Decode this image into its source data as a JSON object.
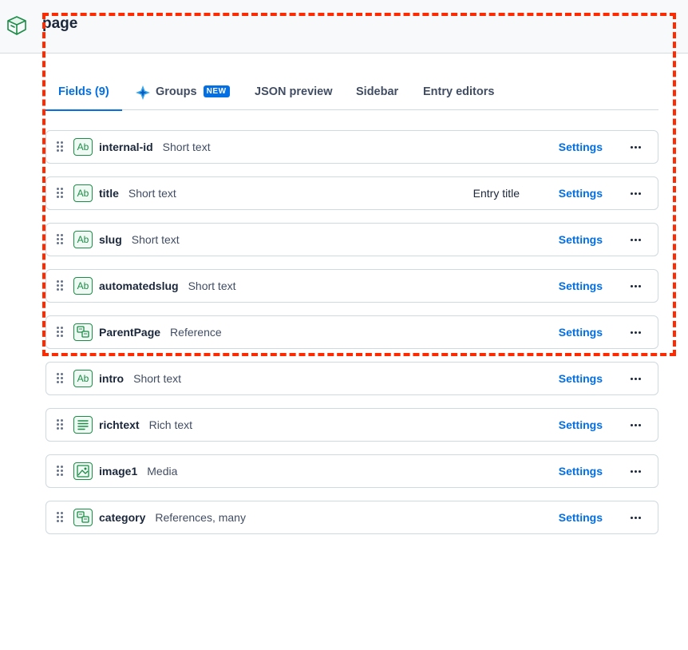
{
  "header": {
    "title": "page"
  },
  "tabs": {
    "fields": "Fields (9)",
    "groups": "Groups",
    "groups_badge": "NEW",
    "json": "JSON preview",
    "sidebar": "Sidebar",
    "entry_editors": "Entry editors"
  },
  "fields": [
    {
      "name": "internal-id",
      "type": "Short text",
      "icon": "short-text-icon",
      "extra": "",
      "settings": "Settings"
    },
    {
      "name": "title",
      "type": "Short text",
      "icon": "short-text-icon",
      "extra": "Entry title",
      "settings": "Settings"
    },
    {
      "name": "slug",
      "type": "Short text",
      "icon": "short-text-icon",
      "extra": "",
      "settings": "Settings"
    },
    {
      "name": "automatedslug",
      "type": "Short text",
      "icon": "short-text-icon",
      "extra": "",
      "settings": "Settings"
    },
    {
      "name": "ParentPage",
      "type": "Reference",
      "icon": "reference-icon",
      "extra": "",
      "settings": "Settings"
    },
    {
      "name": "intro",
      "type": "Short text",
      "icon": "short-text-icon",
      "extra": "",
      "settings": "Settings"
    },
    {
      "name": "richtext",
      "type": "Rich text",
      "icon": "rich-text-icon",
      "extra": "",
      "settings": "Settings"
    },
    {
      "name": "image1",
      "type": "Media",
      "icon": "media-icon",
      "extra": "",
      "settings": "Settings"
    },
    {
      "name": "category",
      "type": "References, many",
      "icon": "reference-icon",
      "extra": "",
      "settings": "Settings"
    }
  ],
  "colors": {
    "accent": "#036fe3",
    "field_icon": "#1c8c47",
    "annotation": "#ff2a00"
  }
}
